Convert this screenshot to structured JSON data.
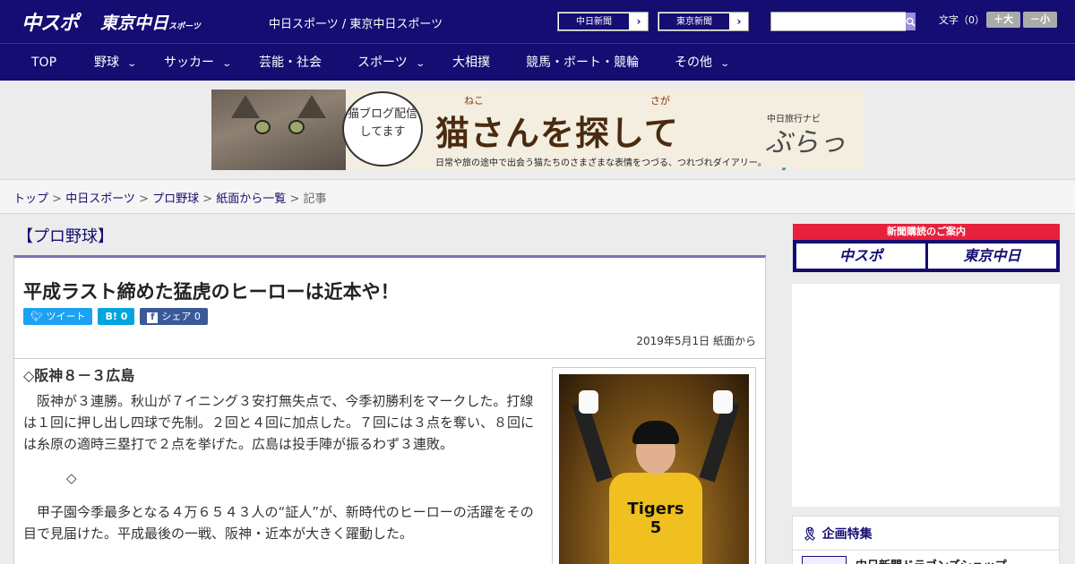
{
  "header": {
    "logo_text": "中スポ",
    "logo2_text": "東京中日",
    "logo2_small": "スポーツ",
    "site_title": "中日スポーツ / 東京中日スポーツ",
    "link1": "中日新聞",
    "link2": "東京新聞",
    "search_placeholder": "",
    "search_icon": "search-icon",
    "fontsize_label": "文字（0）",
    "bigger": "＋大",
    "smaller": "－小"
  },
  "nav": {
    "items": [
      "TOP",
      "野球",
      "サッカー",
      "芸能・社会",
      "スポーツ",
      "大相撲",
      "競馬・ボート・競輪",
      "その他"
    ]
  },
  "banner": {
    "bubble": "猫ブログ配信してます",
    "title": "猫さんを探して",
    "ruby1": "ねこ",
    "ruby2": "さが",
    "nav_label": "中日旅行ナビ",
    "brand_a": "ぶらっ",
    "brand_b": "人",
    "subtitle": "日常や旅の途中で出会う猫たちのさまざまな表情をつづる、つれづれダイアリー。"
  },
  "breadcrumb": {
    "items": [
      "トップ",
      "中日スポーツ",
      "プロ野球",
      "紙面から一覧"
    ],
    "current": "記事"
  },
  "article": {
    "category": "【プロ野球】",
    "headline": "平成ラスト締めた猛虎のヒーローは近本や！",
    "share": {
      "tweet": "ツイート",
      "hatena": "B! 0",
      "facebook": "シェア 0"
    },
    "date": "2019年5月1日 紙面から",
    "subhead": "◇阪神８－３広島",
    "para1": "阪神が３連勝。秋山が７イニング３安打無失点で、今季初勝利をマークした。打線は１回に押し出し四球で先制。２回と４回に加点した。７回には３点を奪い、８回には糸原の適時三塁打で２点を挙げた。広島は投手陣が振るわず３連敗。",
    "diamond": "◇",
    "para2": "甲子園今季最多となる４万６５４３人の“証人”が、新時代のヒーローの活躍をその目で見届けた。平成最後の一戦、阪神・近本が大きく躍動した。",
    "photo_jersey": "Tigers",
    "photo_number": "5"
  },
  "sidebar": {
    "promo_header": "新聞購読のご案内",
    "promo1": "中スポ",
    "promo2": "東京中日",
    "special_header": "企画特集",
    "special_item": "中日新聞ドラゴンズショップ"
  },
  "colors": {
    "brand": "#150d72",
    "accent_red": "#e8203c",
    "twitter": "#1da1f2",
    "hatena": "#00a4de",
    "facebook": "#3b5998"
  }
}
